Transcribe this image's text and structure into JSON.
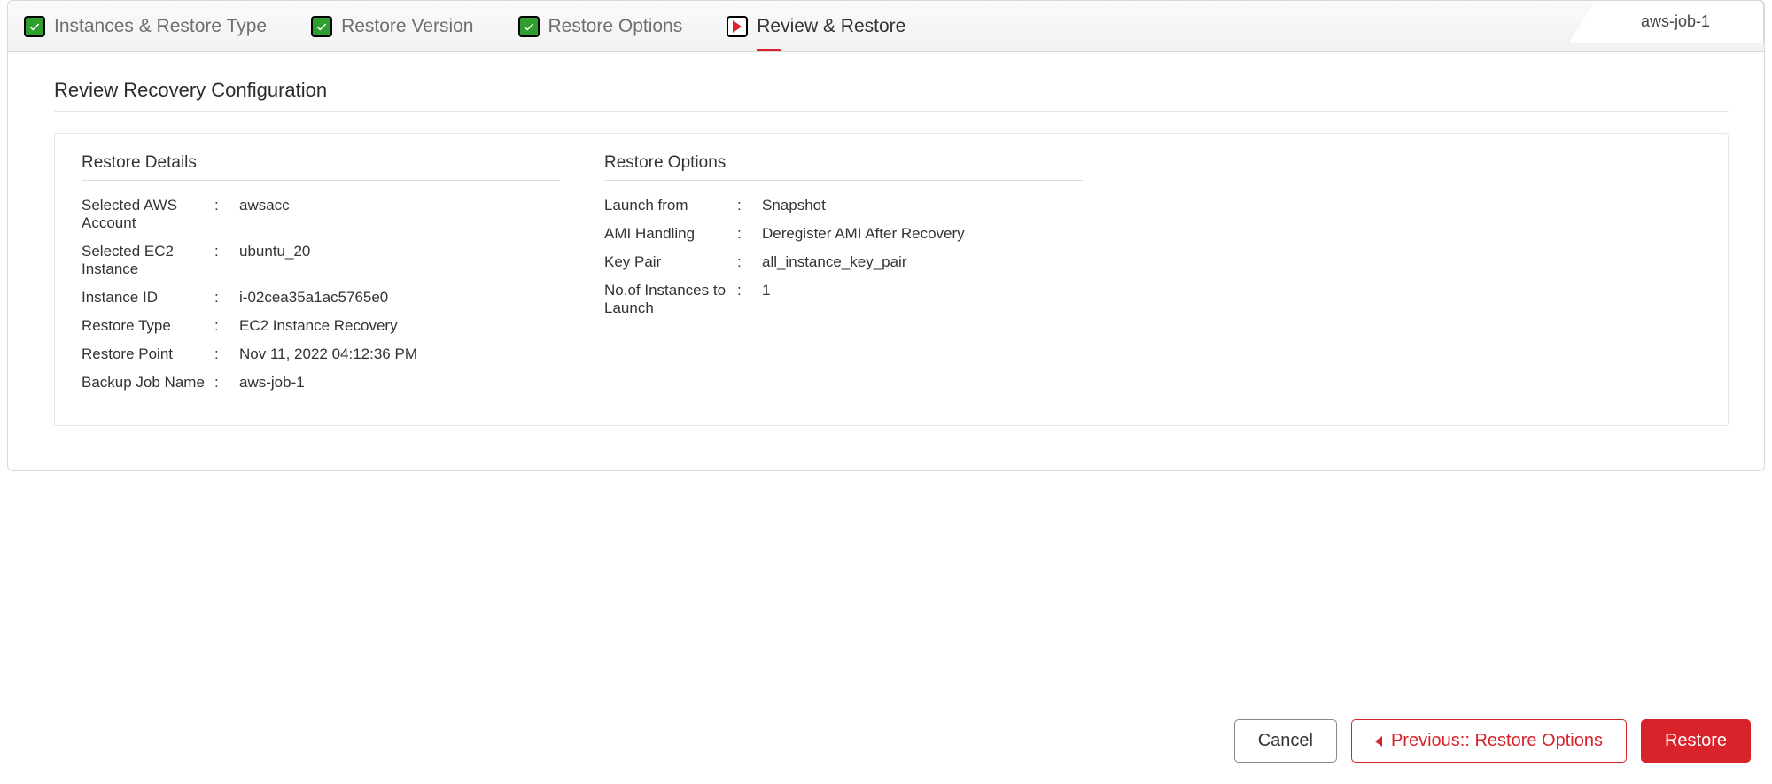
{
  "header": {
    "job_tab": "aws-job-1"
  },
  "steps": {
    "s1": "Instances & Restore Type",
    "s2": "Restore Version",
    "s3": "Restore Options",
    "s4": "Review & Restore"
  },
  "page": {
    "title": "Review Recovery Configuration"
  },
  "details": {
    "title": "Restore Details",
    "rows": {
      "aws_account_label": "Selected AWS Account",
      "aws_account_value": "awsacc",
      "ec2_instance_label": "Selected EC2 Instance",
      "ec2_instance_value": "ubuntu_20",
      "instance_id_label": "Instance ID",
      "instance_id_value": "i-02cea35a1ac5765e0",
      "restore_type_label": "Restore Type",
      "restore_type_value": "EC2 Instance Recovery",
      "restore_point_label": "Restore Point",
      "restore_point_value": "Nov 11, 2022 04:12:36 PM",
      "backup_job_label": "Backup Job Name",
      "backup_job_value": "aws-job-1"
    }
  },
  "options": {
    "title": "Restore Options",
    "rows": {
      "launch_from_label": "Launch from",
      "launch_from_value": "Snapshot",
      "ami_handling_label": "AMI Handling",
      "ami_handling_value": "Deregister AMI After Recovery",
      "key_pair_label": "Key Pair",
      "key_pair_value": "all_instance_key_pair",
      "num_instances_label": "No.of Instances to Launch",
      "num_instances_value": "1"
    }
  },
  "footer": {
    "cancel": "Cancel",
    "previous": "Previous:: Restore Options",
    "restore": "Restore"
  }
}
